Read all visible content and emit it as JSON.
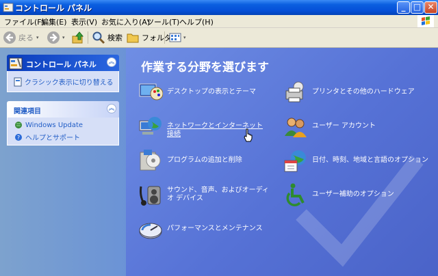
{
  "window": {
    "title": "コントロール パネル",
    "buttons": {
      "minimize": "_",
      "maximize": "□",
      "close": "✕"
    }
  },
  "menu": [
    "ファイル(F)",
    "編集(E)",
    "表示(V)",
    "お気に入り(A)",
    "ツール(T)",
    "ヘルプ(H)"
  ],
  "toolbar": {
    "back_label": "戻る",
    "search_label": "検索",
    "folder_label": "フォルダ"
  },
  "sidebar": {
    "control_panel": {
      "title": "コントロール パネル",
      "link": "クラシック表示に切り替える"
    },
    "related": {
      "title": "関連項目",
      "links": [
        "Windows Update",
        "ヘルプとサポート"
      ]
    }
  },
  "main": {
    "heading": "作業する分野を選びます",
    "categories": [
      {
        "label": "デスクトップの表示とテーマ",
        "icon": "desktop-theme-icon"
      },
      {
        "label": "プリンタとその他のハードウェア",
        "icon": "printer-icon"
      },
      {
        "label": "ネットワークとインターネット接続",
        "icon": "network-globe-icon"
      },
      {
        "label": "ユーザー アカウント",
        "icon": "user-accounts-icon"
      },
      {
        "label": "プログラムの追加と削除",
        "icon": "add-remove-programs-icon"
      },
      {
        "label": "日付、時刻、地域と言語のオプション",
        "icon": "date-time-globe-icon"
      },
      {
        "label": "サウンド、音声、およびオーディオ デバイス",
        "icon": "sound-speaker-icon"
      },
      {
        "label": "ユーザー補助のオプション",
        "icon": "accessibility-icon"
      },
      {
        "label": "パフォーマンスとメンテナンス",
        "icon": "performance-gauge-icon"
      }
    ]
  },
  "colors": {
    "title_blue": "#0550d8",
    "main_bg": "#5672d6",
    "link_blue": "#215dc6"
  }
}
